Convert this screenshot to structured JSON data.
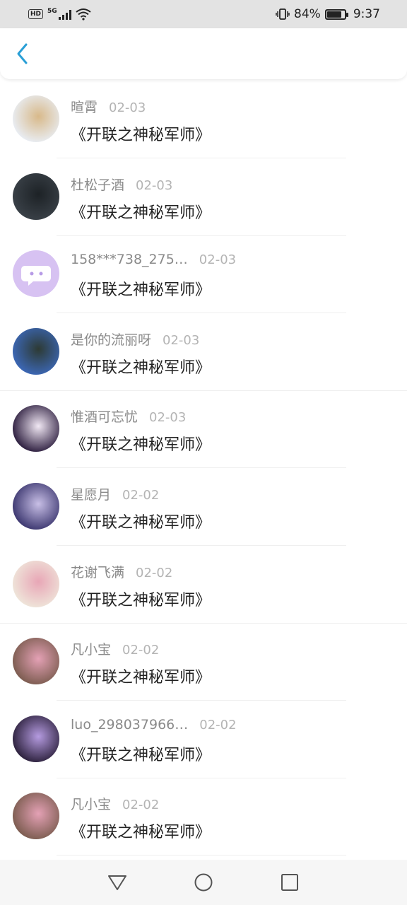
{
  "status_bar": {
    "hd": "HD",
    "network": "5G",
    "battery_percent": "84%",
    "time": "9:37",
    "battery_level": 0.84
  },
  "header": {
    "back_icon": "chevron-left-icon",
    "accent": "#2a9fd6"
  },
  "items": [
    {
      "name": "暄霄",
      "date": "02-03",
      "message": "《开联之神秘军师》",
      "avatar_colors": [
        "#e9eef5",
        "#d8b98a"
      ]
    },
    {
      "name": "杜松子酒",
      "date": "02-03",
      "message": "《开联之神秘军师》",
      "avatar_colors": [
        "#3a4148",
        "#1d2226"
      ]
    },
    {
      "name": "158***738_275…",
      "date": "02-03",
      "message": "《开联之神秘军师》",
      "avatar_colors": [
        "#d7c2f2",
        "#d7c2f2"
      ]
    },
    {
      "name": "是你的流丽呀",
      "date": "02-03",
      "message": "《开联之神秘军师》",
      "avatar_colors": [
        "#3c68b8",
        "#2d3a33"
      ]
    },
    {
      "name": "惟酒可忘忧",
      "date": "02-03",
      "message": "《开联之神秘军师》",
      "avatar_colors": [
        "#2a1b3c",
        "#f1e8f4"
      ]
    },
    {
      "name": "星愿月",
      "date": "02-02",
      "message": "《开联之神秘军师》",
      "avatar_colors": [
        "#3a356e",
        "#c8bfe6"
      ]
    },
    {
      "name": "花谢飞满",
      "date": "02-02",
      "message": "《开联之神秘军师》",
      "avatar_colors": [
        "#efe6da",
        "#e8a6b6"
      ]
    },
    {
      "name": "凡小宝",
      "date": "02-02",
      "message": "《开联之神秘军师》",
      "avatar_colors": [
        "#7a5b4e",
        "#e4a1b5"
      ]
    },
    {
      "name": "luo_298037966…",
      "date": "02-02",
      "message": "《开联之神秘军师》",
      "avatar_colors": [
        "#2a1f3a",
        "#b59be0"
      ]
    },
    {
      "name": "凡小宝",
      "date": "02-02",
      "message": "《开联之神秘军师》",
      "avatar_colors": [
        "#7a5b4e",
        "#e4a1b5"
      ]
    }
  ],
  "nav_bar": {
    "back_icon": "triangle-back-icon",
    "home_icon": "circle-home-icon",
    "recents_icon": "square-recents-icon"
  }
}
